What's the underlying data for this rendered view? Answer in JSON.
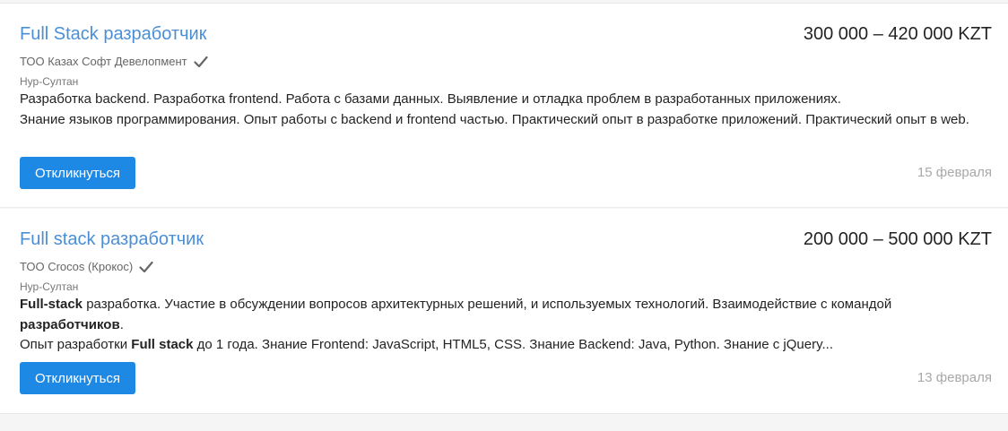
{
  "vacancies": [
    {
      "title": "Full Stack разработчик",
      "salary": "300 000 – 420 000 KZT",
      "company": "ТОО Казах Софт Девелопмент",
      "city": "Нур-Султан",
      "desc_line1": "Разработка backend. Разработка frontend. Работа с базами данных. Выявление и отладка проблем в разработанных приложениях.",
      "desc_line2": "Знание языков программирования. Опыт работы с backend и frontend частью. Практический опыт в разработке приложений. Практический опыт в web.",
      "button": "Откликнуться",
      "date": "15 февраля",
      "verified_icon": "check-icon"
    },
    {
      "title": "Full stack разработчик",
      "salary": "200 000 – 500 000 KZT",
      "company": "ТОО Crocos (Крокос)",
      "city": "Нур-Султан",
      "desc1_bold_a": "Full-stack",
      "desc1_text_a": " разработка. Участие в обсуждении вопросов архитектурных решений, и используемых технологий. Взаимодействие с командой ",
      "desc1_bold_b": "разработчиков",
      "desc1_text_b": ".",
      "desc2_text_a": "Опыт разработки ",
      "desc2_bold_a": "Full stack",
      "desc2_text_b": " до 1 года. Знание Frontend: JavaScript, HTML5, CSS. Знание Backend: Java, Python. Знание с jQuery...",
      "button": "Откликнуться",
      "date": "13 февраля",
      "verified_icon": "check-icon"
    }
  ],
  "colors": {
    "link": "#4a8fd6",
    "button": "#1e88e5",
    "muted": "#a8a8a8"
  }
}
